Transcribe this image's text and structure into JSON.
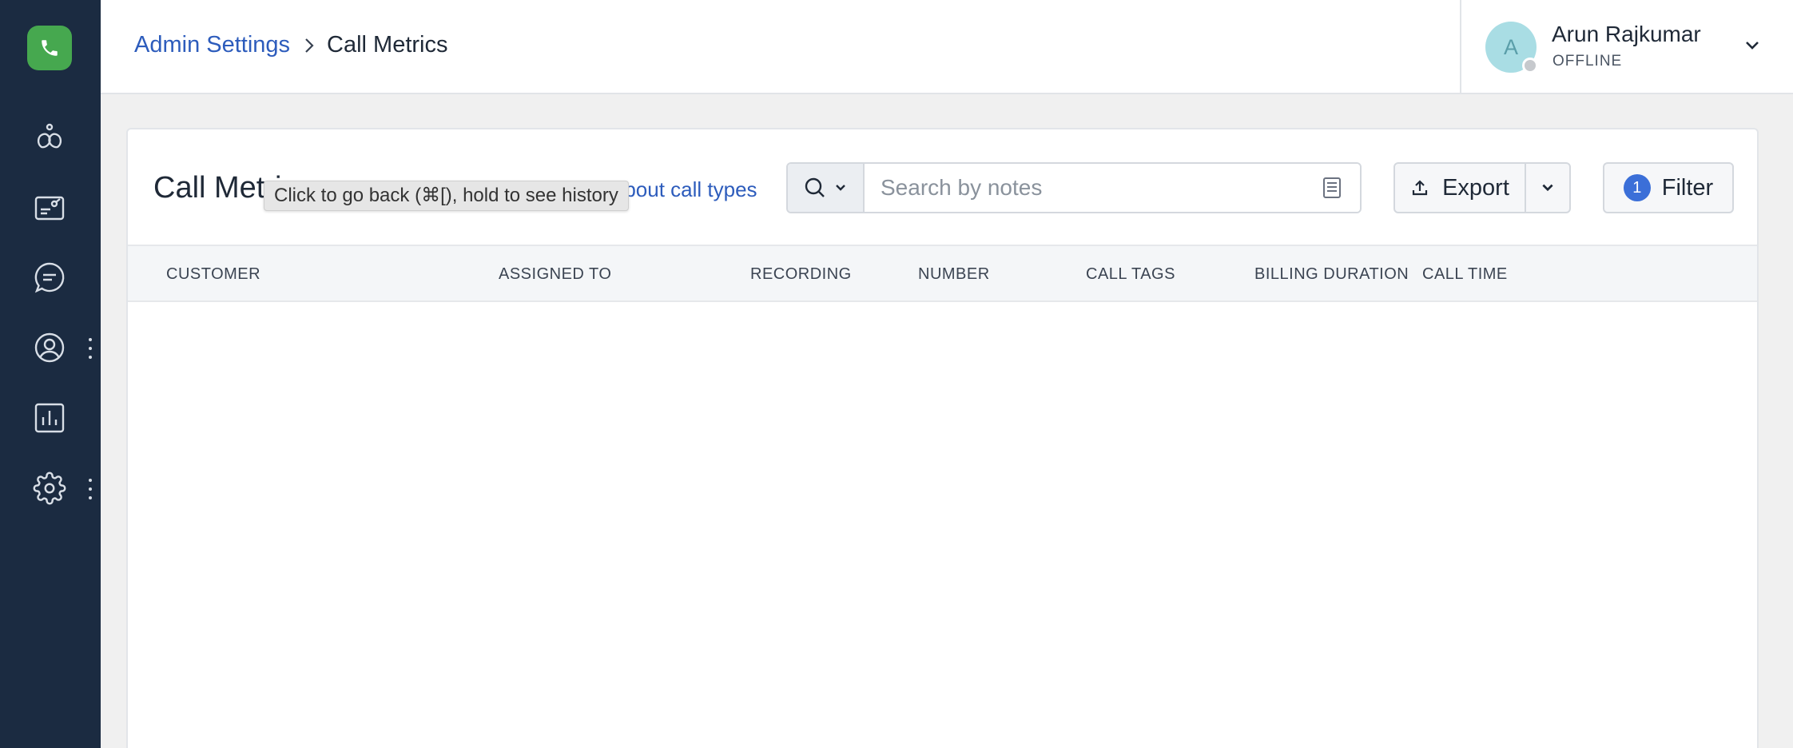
{
  "breadcrumb": {
    "parent": "Admin Settings",
    "current": "Call Metrics"
  },
  "user": {
    "initial": "A",
    "name": "Arun Rajkumar",
    "status": "OFFLINE"
  },
  "page": {
    "title": "Call Metrics",
    "about_link": "About call types"
  },
  "tooltip": {
    "text": "Click to go back (⌘[), hold to see history"
  },
  "search": {
    "placeholder": "Search by notes",
    "value": ""
  },
  "toolbar": {
    "export_label": "Export",
    "filter_label": "Filter",
    "filter_count": "1"
  },
  "table": {
    "columns": [
      "CUSTOMER",
      "ASSIGNED TO",
      "RECORDING",
      "NUMBER",
      "CALL TAGS",
      "BILLING DURATION",
      "CALL TIME"
    ],
    "rows": []
  },
  "sidebar": {
    "items": [
      {
        "icon": "omnichannel-icon"
      },
      {
        "icon": "dashboard-icon"
      },
      {
        "icon": "chat-icon"
      },
      {
        "icon": "contacts-icon"
      },
      {
        "icon": "analytics-icon"
      },
      {
        "icon": "settings-icon"
      }
    ]
  },
  "colors": {
    "sidebar_bg": "#1b2b41",
    "brand_green": "#46a84f",
    "link_blue": "#2d5cbc",
    "badge_blue": "#3b6fd8"
  }
}
